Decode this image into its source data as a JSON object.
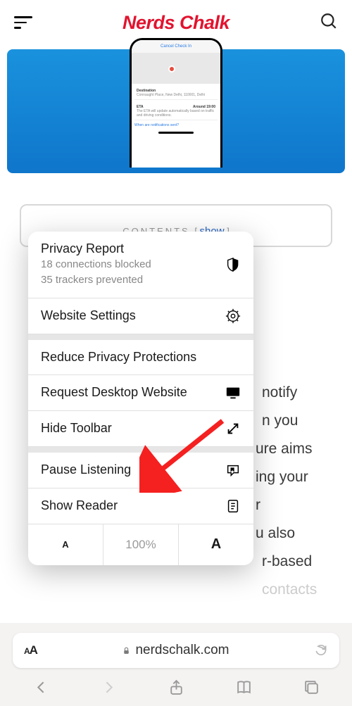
{
  "header": {
    "logo": "Nerds Chalk"
  },
  "phone": {
    "cancel": "Cancel Check In",
    "dest_label": "Destination",
    "dest_value": "Connaught Place, New Delhi, 110001, Delhi",
    "eta_label": "ETA",
    "eta_value": "Around 19:00",
    "eta_note": "The ETA will update automatically based on traffic and driving conditions.",
    "link": "When are notifications sent?"
  },
  "contents": {
    "label": "CONTENTS",
    "show": "show"
  },
  "bgtext": {
    "t1": "notify",
    "t2": "n you",
    "t3": "ure aims",
    "t4": "ing your",
    "t5": "r",
    "t6": "u also",
    "t7": "r-based",
    "t8": "contacts"
  },
  "menu": {
    "privacy_title": "Privacy Report",
    "privacy_sub1": "18 connections blocked",
    "privacy_sub2": "35 trackers prevented",
    "website_settings": "Website Settings",
    "reduce": "Reduce Privacy Protections",
    "desktop": "Request Desktop Website",
    "hide_toolbar": "Hide Toolbar",
    "pause": "Pause Listening",
    "reader": "Show Reader",
    "zoom": "100%"
  },
  "urlbar": {
    "domain": "nerdschalk.com"
  }
}
